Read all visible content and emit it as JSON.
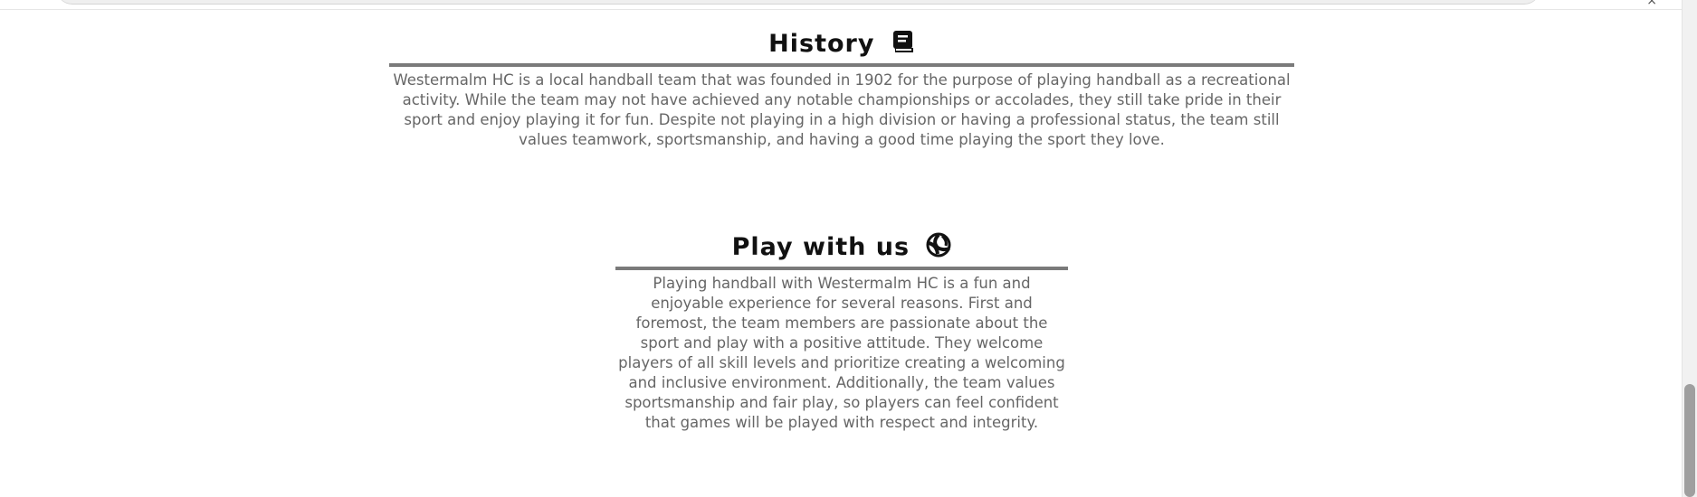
{
  "window_controls": {
    "close_label": "×"
  },
  "sections": {
    "history": {
      "title": "History",
      "icon": "book-icon",
      "body": "Westermalm HC is a local handball team that was founded in 1902 for the purpose of playing handball as a recreational activity. While the team may not have achieved any notable championships or accolades, they still take pride in their sport and enjoy playing it for fun. Despite not playing in a high division or having a professional status, the team still values teamwork, sportsmanship, and having a good time playing the sport they love."
    },
    "play": {
      "title": "Play with us",
      "icon": "handball-icon",
      "body": "Playing handball with Westermalm HC is a fun and enjoyable experience for several reasons. First and foremost, the team members are passionate about the sport and play with a positive attitude. They welcome players of all skill levels and prioritize creating a welcoming and inclusive environment. Additionally, the team values sportsmanship and fair play, so players can feel confident that games will be played with respect and integrity."
    }
  },
  "colors": {
    "heading": "#111111",
    "body_text": "#666666",
    "underline": "#7a7a7a"
  }
}
